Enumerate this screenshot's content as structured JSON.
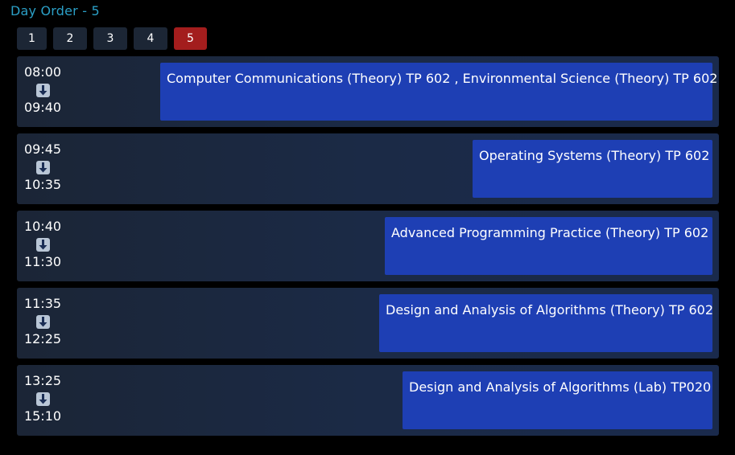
{
  "header": {
    "title": "Day Order - 5"
  },
  "day_tabs": [
    {
      "label": "1",
      "active": false
    },
    {
      "label": "2",
      "active": false
    },
    {
      "label": "3",
      "active": false
    },
    {
      "label": "4",
      "active": false
    },
    {
      "label": "5",
      "active": true
    }
  ],
  "schedule": [
    {
      "start": "08:00",
      "end": "09:40",
      "course": "Computer Communications (Theory) TP 602 , Environmental Science (Theory) TP 602"
    },
    {
      "start": "09:45",
      "end": "10:35",
      "course": "Operating Systems (Theory) TP 602"
    },
    {
      "start": "10:40",
      "end": "11:30",
      "course": "Advanced Programming Practice (Theory) TP 602"
    },
    {
      "start": "11:35",
      "end": "12:25",
      "course": "Design and Analysis of Algorithms (Theory) TP 602"
    },
    {
      "start": "13:25",
      "end": "15:10",
      "course": "Design and Analysis of Algorithms (Lab) TP020"
    }
  ],
  "icons": {
    "arrow": "down-arrow-icon"
  },
  "colors": {
    "title": "#2b9fc6",
    "active_tab": "#a31d1d",
    "tab": "#1c2635",
    "course_block": "#1e3fb4",
    "row_background": "#1b2536"
  }
}
